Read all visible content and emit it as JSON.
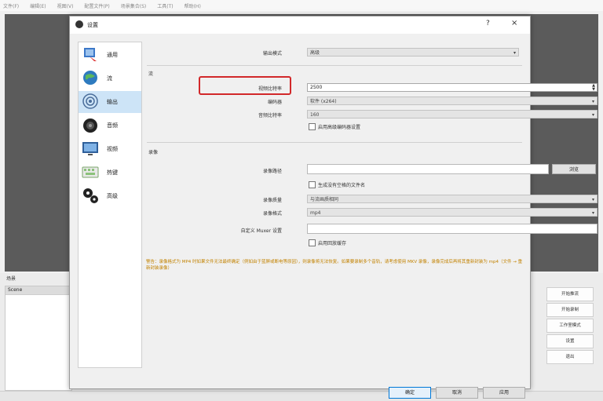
{
  "menubar": [
    "文件(F)",
    "编辑(E)",
    "视图(V)",
    "配置文件(P)",
    "场景集合(S)",
    "工具(T)",
    "帮助(H)"
  ],
  "scene": {
    "label": "场景",
    "first_row": "Scene"
  },
  "controls": [
    "开始推流",
    "开始录制",
    "工作室模式",
    "设置",
    "退出"
  ],
  "dialog": {
    "title": "设置",
    "help": "?",
    "close": "×",
    "sidebar": [
      "通用",
      "流",
      "输出",
      "音频",
      "视频",
      "热键",
      "高级"
    ],
    "selected": "输出",
    "output_mode_label": "输出模式",
    "output_mode_value": "高级",
    "stream_section": "流",
    "bitrate_label": "视频比特率",
    "bitrate_value": "2500",
    "encoder_label": "编码器",
    "encoder_value": "软件 (x264)",
    "audio_bitrate_label": "音频比特率",
    "audio_bitrate_value": "160",
    "advanced_encoder_chk": "启用高级编码器设置",
    "record_section": "录像",
    "record_path_label": "录像路径",
    "browse_label": "浏览",
    "no_space_chk": "生成没有空格的文件名",
    "record_quality_label": "录像质量",
    "record_quality_value": "与流画质相同",
    "record_format_label": "录像格式",
    "record_format_value": "mp4",
    "muxer_label": "自定义 Muxer 设置",
    "replay_chk": "启用回放缓存",
    "warning": "警告：录像格式为 MP4 时如果文件无法最终确定（例如由于蓝屏或断电等原因），则录像将无法恢复。如果要录制多个音轨，请考虑使用 MKV 录像，录像完成后再将其重新封装为 mp4（文件 → 重新封装录像）",
    "ok": "确定",
    "cancel": "取消",
    "apply": "应用"
  }
}
